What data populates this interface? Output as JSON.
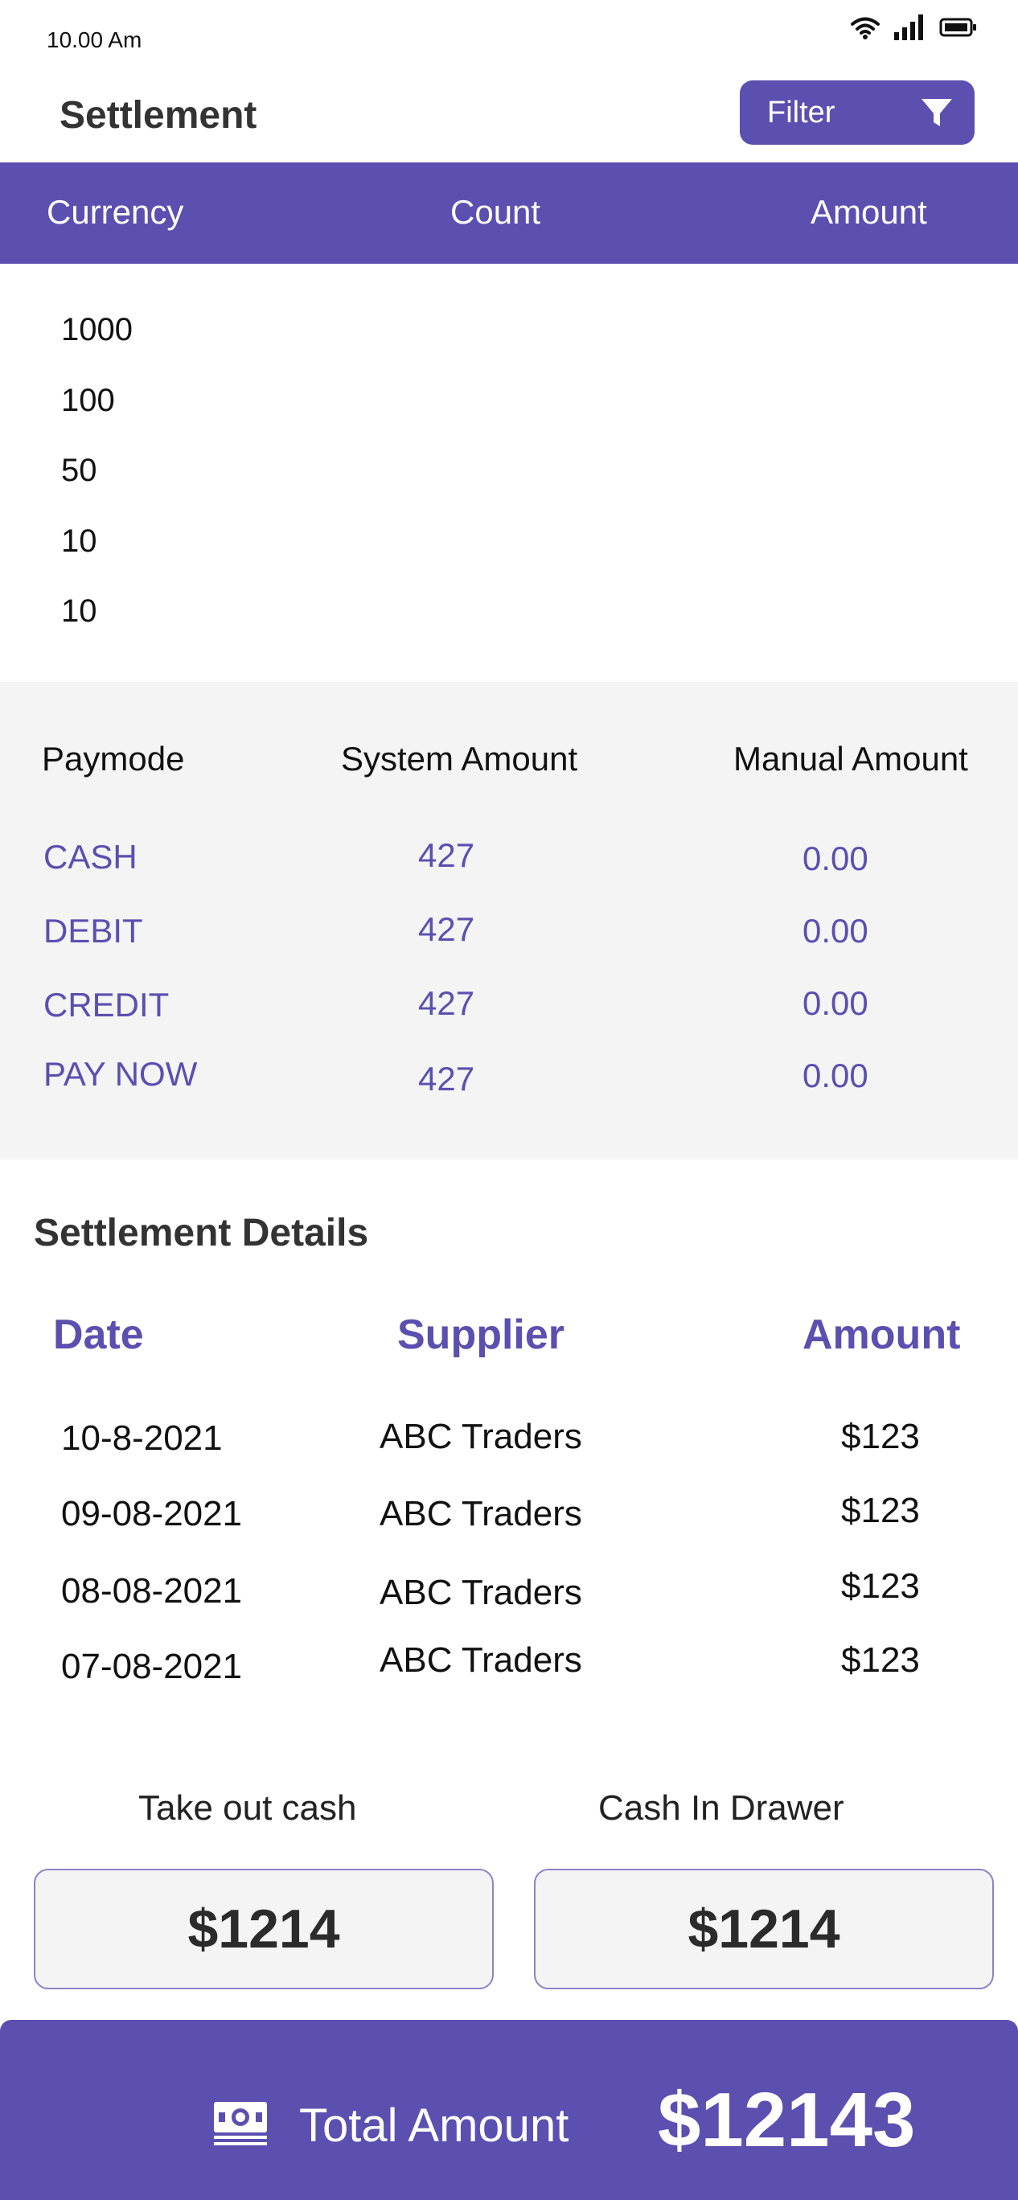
{
  "status_bar": {
    "time": "10.00 Am"
  },
  "header": {
    "title": "Settlement",
    "filter_label": "Filter"
  },
  "currency_table": {
    "headers": [
      "Currency",
      "Count",
      "Amount"
    ],
    "rows": [
      "1000",
      "100",
      "50",
      "10",
      "10"
    ]
  },
  "paymode_table": {
    "headers": [
      "Paymode",
      "System Amount",
      "Manual Amount"
    ],
    "rows": [
      {
        "mode": "CASH",
        "system": "427",
        "manual": "0.00"
      },
      {
        "mode": "DEBIT",
        "system": "427",
        "manual": "0.00"
      },
      {
        "mode": "CREDIT",
        "system": "427",
        "manual": "0.00"
      },
      {
        "mode": "PAY NOW",
        "system": "427",
        "manual": "0.00"
      }
    ]
  },
  "settlement_details": {
    "title": "Settlement Details",
    "headers": [
      "Date",
      "Supplier",
      "Amount"
    ],
    "rows": [
      {
        "date": "10-8-2021",
        "supplier": "ABC Traders",
        "amount": "$123"
      },
      {
        "date": "09-08-2021",
        "supplier": "ABC Traders",
        "amount": "$123"
      },
      {
        "date": "08-08-2021",
        "supplier": "ABC Traders",
        "amount": "$123"
      },
      {
        "date": "07-08-2021",
        "supplier": "ABC Traders",
        "amount": "$123"
      }
    ]
  },
  "cash": {
    "take_out_label": "Take out cash",
    "take_out_value": "$1214",
    "drawer_label": "Cash In Drawer",
    "drawer_value": "$1214"
  },
  "total": {
    "label": "Total Amount",
    "value": "$12143"
  },
  "colors": {
    "accent": "#5b4fb0",
    "panel": "#f4f4f4"
  },
  "icons": [
    "wifi-icon",
    "signal-icon",
    "battery-icon",
    "filter-icon",
    "cash-icon"
  ]
}
